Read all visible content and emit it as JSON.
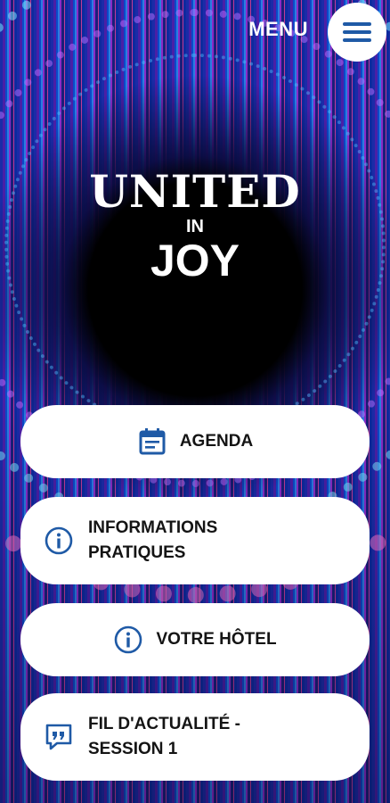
{
  "header": {
    "menu_label": "MENU"
  },
  "logo": {
    "line1": "UNITED",
    "line2": "IN",
    "line3": "JOY"
  },
  "nav": {
    "agenda": {
      "label": "AGENDA",
      "icon": "calendar-icon"
    },
    "informations": {
      "label": "INFORMATIONS\nPRATIQUES",
      "icon": "info-icon"
    },
    "hotel": {
      "label": "VOTRE HÔTEL",
      "icon": "info-icon"
    },
    "fil": {
      "label": "FIL D'ACTUALITÉ -\nSESSION 1",
      "icon": "quote-bubble-icon"
    }
  },
  "colors": {
    "accent": "#1f5aa6",
    "button_bg": "#ffffff",
    "button_text": "#141414"
  }
}
